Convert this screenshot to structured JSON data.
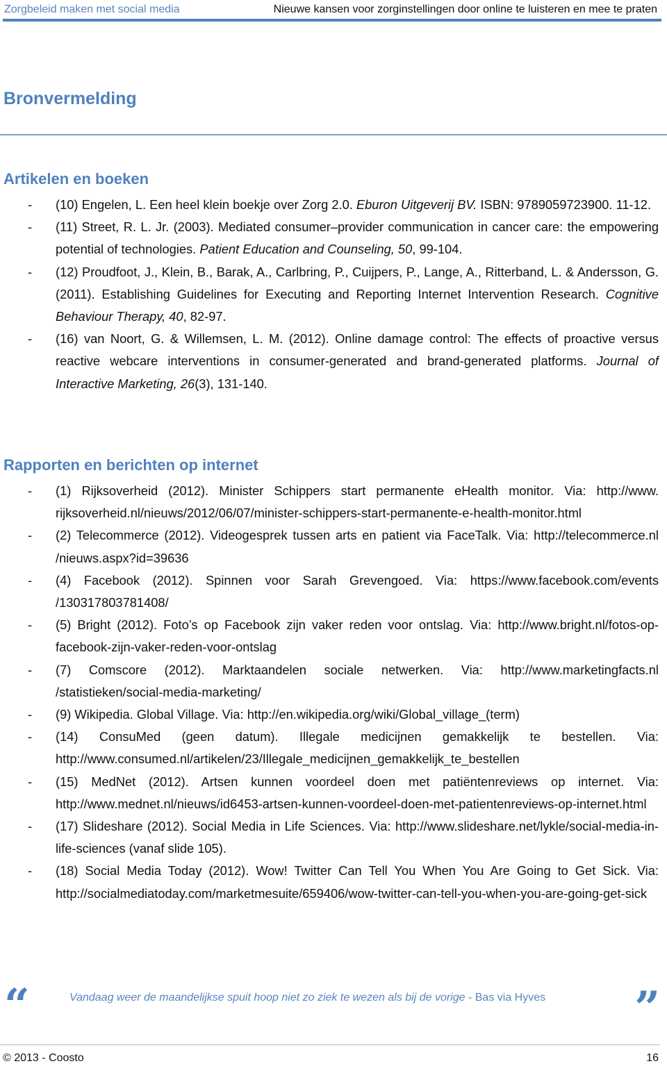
{
  "header": {
    "left": "Zorgbeleid maken met social media",
    "right": "Nieuwe kansen voor zorginstellingen door online te luisteren en mee te praten"
  },
  "title": "Bronvermelding",
  "sections": [
    {
      "heading": "Artikelen en boeken",
      "items": [
        {
          "bullet": "-",
          "parts": [
            {
              "text": "(10) Engelen, L. Een heel klein boekje over Zorg 2.0. "
            },
            {
              "text": "Eburon Uitgeverij BV.",
              "italic": true
            },
            {
              "text": " ISBN: 9789059723900. 11-12."
            }
          ]
        },
        {
          "bullet": "-",
          "parts": [
            {
              "text": "(11) Street, R. L. Jr. (2003). Mediated consumer–provider communication in cancer care: the empowering potential of technologies. "
            },
            {
              "text": "Patient Education and Counseling, 50",
              "italic": true
            },
            {
              "text": ", 99-104."
            }
          ]
        },
        {
          "bullet": "-",
          "parts": [
            {
              "text": "(12) Proudfoot, J., Klein, B., Barak, A., Carlbring, P., Cuijpers, P., Lange, A., Ritterband, L. & Andersson, G. (2011). Establishing Guidelines for Executing and Reporting Internet Intervention Research. "
            },
            {
              "text": "Cognitive Behaviour Therapy, 40",
              "italic": true
            },
            {
              "text": ", 82-97."
            }
          ]
        },
        {
          "bullet": "-",
          "parts": [
            {
              "text": "(16) van Noort, G. & Willemsen, L. M. (2012). Online damage control: The effects of proactive versus reactive webcare interventions in consumer-generated and brand-generated platforms. "
            },
            {
              "text": "Journal of Interactive Marketing, 26",
              "italic": true
            },
            {
              "text": "(3), 131-140."
            }
          ]
        }
      ]
    },
    {
      "heading": "Rapporten en berichten op internet",
      "items": [
        {
          "bullet": "-",
          "parts": [
            {
              "text": "(1) Rijksoverheid (2012). Minister Schippers start permanente eHealth monitor. Via: http://www.     rijksoverheid.nl/nieuws/2012/06/07/minister-schippers-start-permanente-e-health-monitor.html"
            }
          ]
        },
        {
          "bullet": "-",
          "parts": [
            {
              "text": "(2) Telecommerce (2012). Videogesprek tussen arts en patient via FaceTalk. Via: http://telecommerce.nl /nieuws.aspx?id=39636"
            }
          ]
        },
        {
          "bullet": "-",
          "parts": [
            {
              "text": "(4) Facebook (2012). Spinnen voor Sarah Grevengoed. Via: https://www.facebook.com/events /130317803781408/"
            }
          ]
        },
        {
          "bullet": "-",
          "parts": [
            {
              "text": "(5) Bright (2012). Foto’s op Facebook zijn vaker reden voor ontslag. Via: http://www.bright.nl/fotos-op-facebook-zijn-vaker-reden-voor-ontslag"
            }
          ]
        },
        {
          "bullet": "-",
          "parts": [
            {
              "text": "(7) Comscore (2012). Marktaandelen sociale netwerken. Via: http://www.marketingfacts.nl /statistieken/social-media-marketing/"
            }
          ]
        },
        {
          "bullet": "-",
          "parts": [
            {
              "text": "(9) Wikipedia. Global Village. Via: http://en.wikipedia.org/wiki/Global_village_(term)"
            }
          ]
        },
        {
          "bullet": "-",
          "parts": [
            {
              "text": "(14) ConsuMed (geen datum). Illegale medicijnen gemakkelijk te bestellen. Via: http://www.consumed.nl/artikelen/23/Illegale_medicijnen_gemakkelijk_te_bestellen"
            }
          ]
        },
        {
          "bullet": "-",
          "parts": [
            {
              "text": "(15) MedNet (2012). Artsen kunnen voordeel doen met patiëntenreviews op internet. Via: http://www.mednet.nl/nieuws/id6453-artsen-kunnen-voordeel-doen-met-patientenreviews-op-internet.html"
            }
          ]
        },
        {
          "bullet": "-",
          "parts": [
            {
              "text": "(17) Slideshare (2012). Social Media in Life Sciences. Via: http://www.slideshare.net/lykle/social-media-in-life-sciences (vanaf slide 105)."
            }
          ]
        },
        {
          "bullet": "-",
          "parts": [
            {
              "text": "(18) Social Media Today (2012). Wow! Twitter Can Tell You When You Are Going to Get Sick. Via:    http://socialmediatoday.com/marketmesuite/659406/wow-twitter-can-tell-you-when-you-are-going-get-sick"
            }
          ]
        }
      ]
    }
  ],
  "quote": {
    "open_mark": "“",
    "close_mark": "”",
    "text": "Vandaag weer de maandelijkse spuit hoop niet zo ziek te wezen als bij de vorige",
    "attribution": " - Bas via Hyves"
  },
  "footer": {
    "copyright": "© 2013 - Coosto",
    "page_number": "16"
  },
  "colors": {
    "accent": "#4f81bd",
    "header_text": "#5b84bd",
    "body_text": "#111111"
  }
}
